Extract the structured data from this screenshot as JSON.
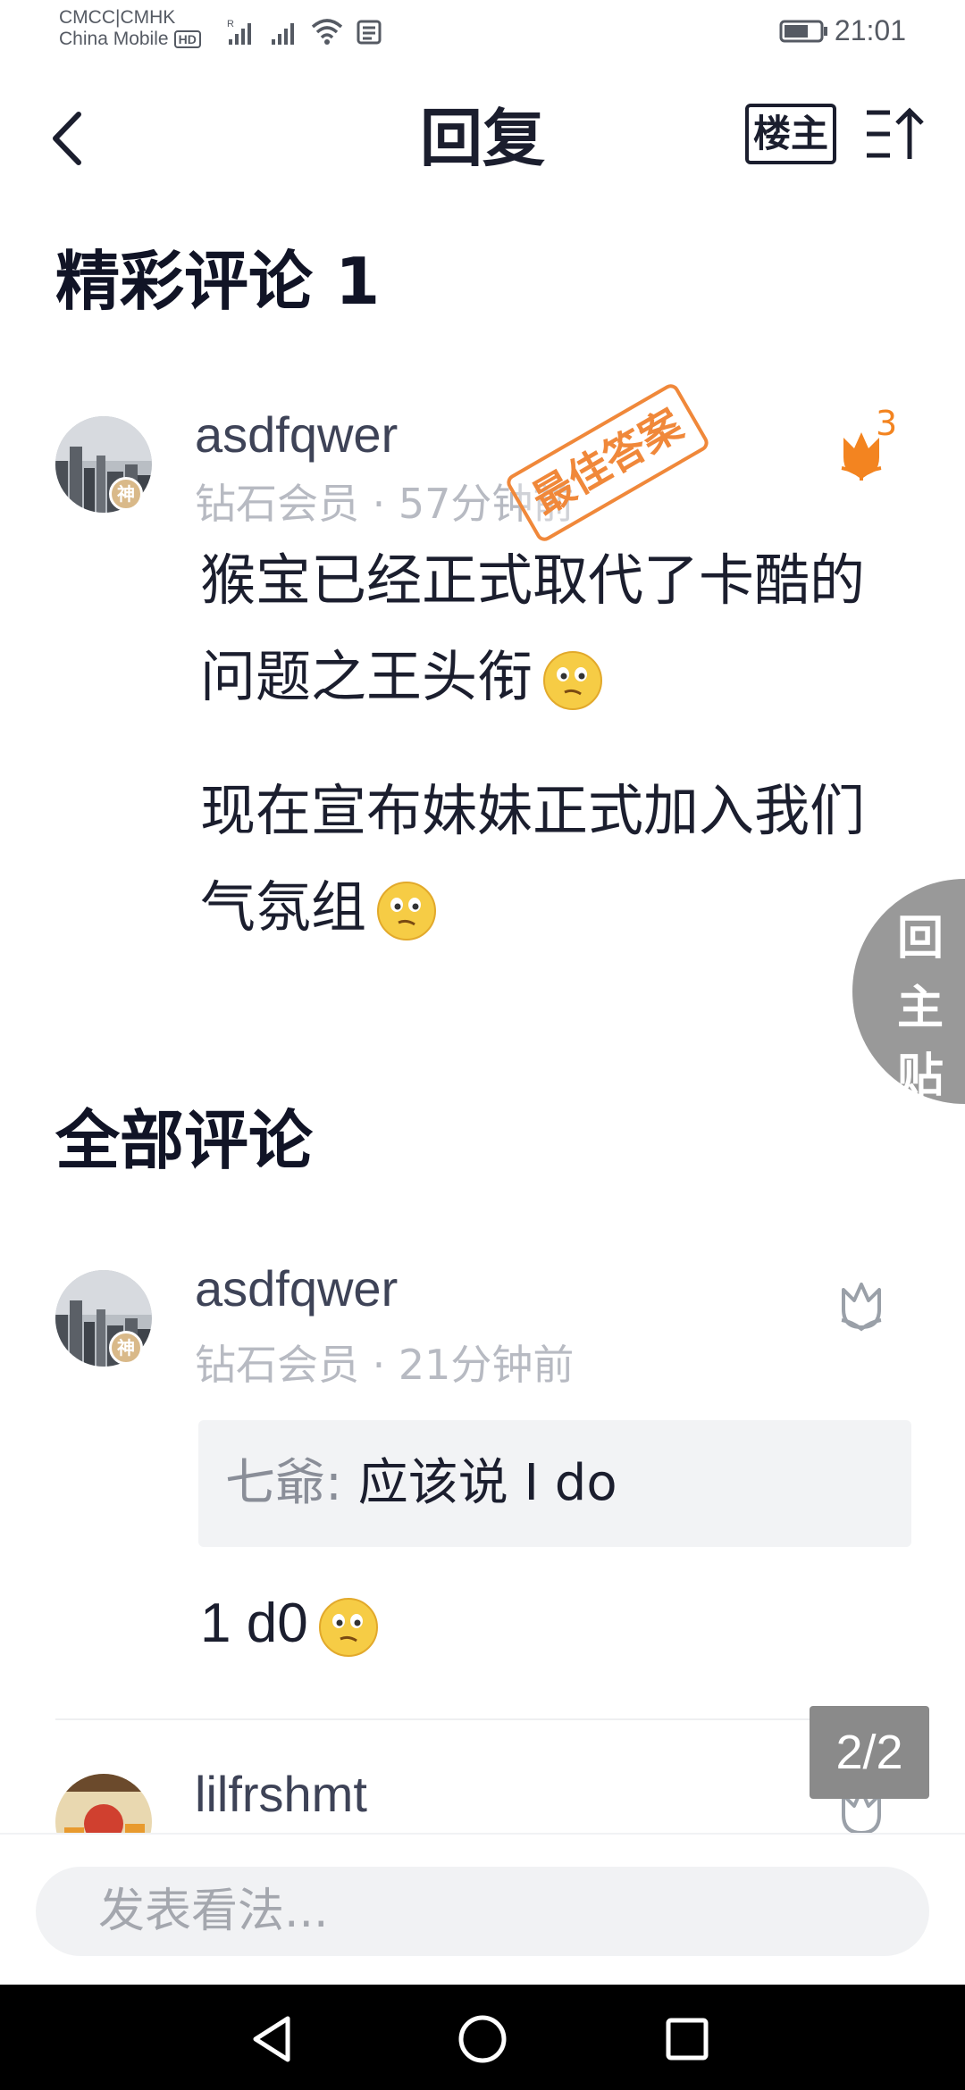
{
  "status_bar": {
    "carrier_line1": "CMCC|CMHK",
    "carrier_line2": "China Mobile",
    "hd_label": "HD",
    "time": "21:01"
  },
  "header": {
    "title": "回复",
    "op_filter_label": "楼主"
  },
  "featured": {
    "title": "精彩评论 1",
    "best_answer_stamp": "最佳答案",
    "comment": {
      "avatar_badge": "神",
      "username": "asdfqwer",
      "meta": "钻石会员 · 57分钟前",
      "like_count": "3",
      "paragraph1": "猴宝已经正式取代了卡酷的问题之王头衔",
      "paragraph2": "现在宣布妹妹正式加入我们气氛组"
    }
  },
  "all_comments": {
    "title": "全部评论",
    "items": [
      {
        "avatar_badge": "神",
        "username": "asdfqwer",
        "meta": "钻石会员 · 21分钟前",
        "quote_author": "七爺:",
        "quote_text": "应该说 I do",
        "text": "1 d0"
      },
      {
        "username": "lilfrshmt"
      }
    ]
  },
  "floating_back": [
    "回",
    "主",
    "贴"
  ],
  "page_indicator": "2/2",
  "input": {
    "placeholder": "发表看法..."
  },
  "colors": {
    "like_active": "#f38420",
    "like_inactive": "#9aa0a8",
    "stamp": "#f0883a",
    "title_dark": "#111426",
    "nav_bar": "#000000"
  }
}
